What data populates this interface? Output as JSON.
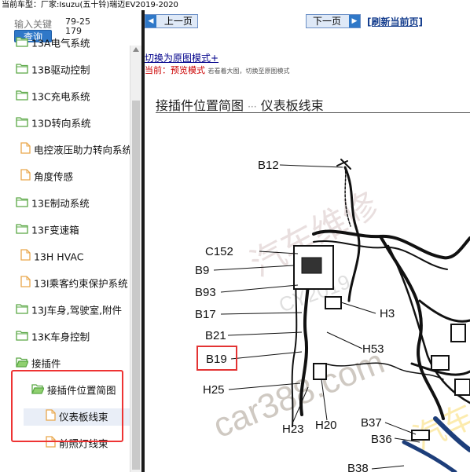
{
  "header": {
    "vehicle_label": "当前车型：",
    "vehicle_value": "厂家:Isuzu(五十铃)瑞迈EV2019-2020"
  },
  "search": {
    "placeholder": "输入关键",
    "button": "查询",
    "code": "79-25179"
  },
  "tree": [
    {
      "label": "13A电气系统",
      "type": "folder",
      "level": 0
    },
    {
      "label": "13B驱动控制",
      "type": "folder",
      "level": 0
    },
    {
      "label": "13C充电系统",
      "type": "folder",
      "level": 0
    },
    {
      "label": "13D转向系统",
      "type": "folder",
      "level": 0
    },
    {
      "label": "电控液压助力转向系统",
      "type": "doc",
      "level": 1
    },
    {
      "label": "角度传感",
      "type": "doc",
      "level": 1
    },
    {
      "label": "13E制动系统",
      "type": "folder",
      "level": 0
    },
    {
      "label": "13F变速箱",
      "type": "folder",
      "level": 0
    },
    {
      "label": "13H HVAC",
      "type": "doc",
      "level": 1
    },
    {
      "label": "13I乘客约束保护系统",
      "type": "doc",
      "level": 1
    },
    {
      "label": "13J车身,驾驶室,附件",
      "type": "folder",
      "level": 0
    },
    {
      "label": "13K车身控制",
      "type": "folder",
      "level": 0
    },
    {
      "label": "接插件",
      "type": "folder",
      "level": 0
    },
    {
      "label": "接插件位置简图",
      "type": "folder",
      "level": 1
    },
    {
      "label": "仪表板线束",
      "type": "doc",
      "level": 2,
      "selected": true
    },
    {
      "label": "前照灯线束",
      "type": "doc",
      "level": 2
    }
  ],
  "nav": {
    "prev": "上一页",
    "next": "下一页",
    "refresh": "[刷新当前页]"
  },
  "view": {
    "switch_link": "切换为原图模式+",
    "current_label": "当前：",
    "current_mode": "预览模式",
    "current_hint": "若看着大图，切换至原图模式"
  },
  "section": {
    "title": "接插件位置简图",
    "sep": "···",
    "subtitle": "仪表板线束"
  },
  "diagram": {
    "labels": [
      "B12",
      "C152",
      "B9",
      "B93",
      "B17",
      "B21",
      "B19",
      "H25",
      "H3",
      "H53",
      "H23",
      "H20",
      "B37",
      "B36",
      "B38"
    ],
    "highlighted": "B19",
    "watermark": "car388.com",
    "watermark2": "汽车维修",
    "watermark3": "CY2019",
    "colors": {
      "highlight": "#e33333",
      "folder": "#6fbf5a",
      "doc": "#f2b65a",
      "accent": "#2f78c8"
    }
  }
}
